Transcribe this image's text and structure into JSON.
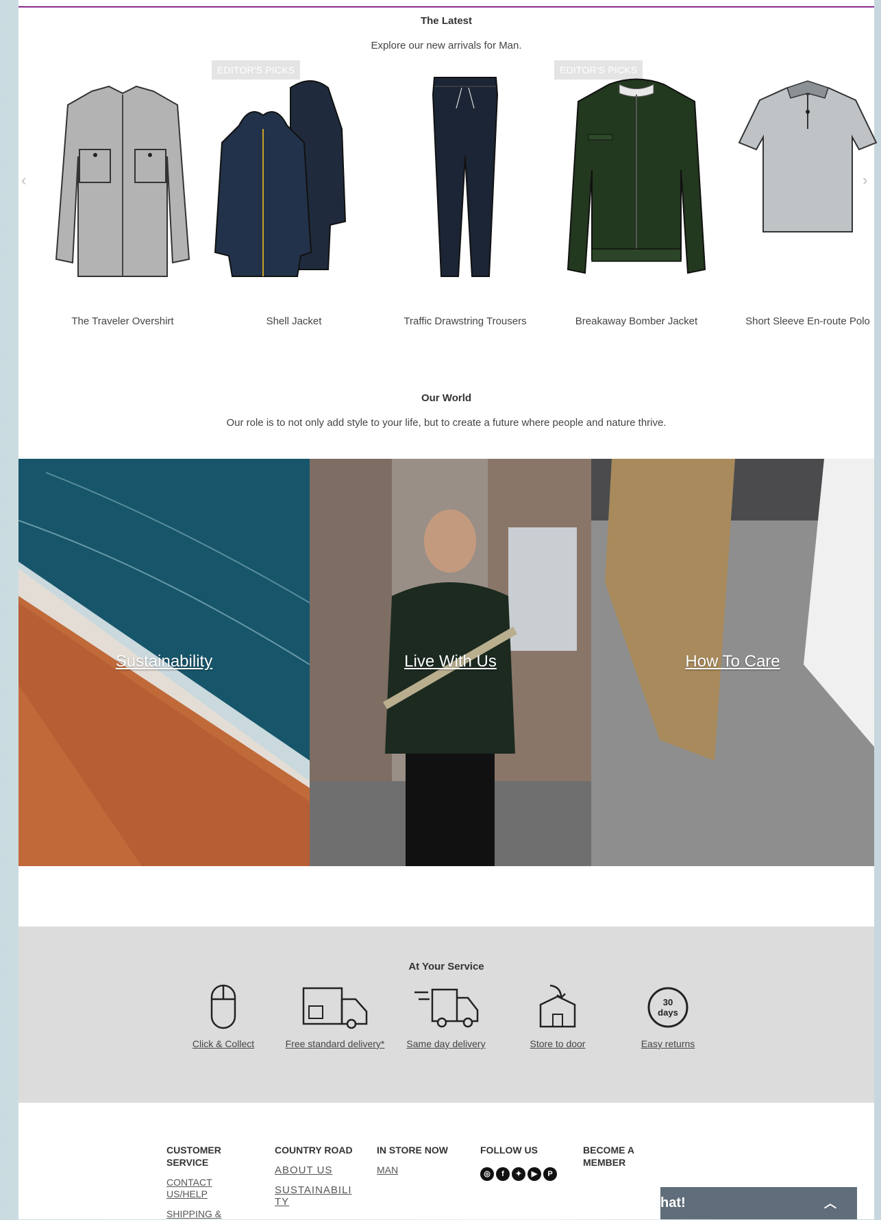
{
  "latest": {
    "title": "The Latest",
    "subtitle": "Explore our new arrivals for Man.",
    "badge": "EDITOR'S PICKS",
    "products": [
      {
        "name": "The Traveler Overshirt",
        "color": "#b3b3b3",
        "editors_pick": false
      },
      {
        "name": "Shell Jacket",
        "color": "#1f2b3d",
        "editors_pick": true
      },
      {
        "name": "Traffic Drawstring Trousers",
        "color": "#1c2535",
        "editors_pick": false
      },
      {
        "name": "Breakaway Bomber Jacket",
        "color": "#23391f",
        "editors_pick": true
      },
      {
        "name": "Short Sleeve En-route Polo",
        "color": "#bfc3c6",
        "editors_pick": false
      }
    ],
    "prev_icon": "chevron-left-icon",
    "next_icon": "chevron-right-icon",
    "next_glyph": "›"
  },
  "world": {
    "title": "Our World",
    "subtitle": "Our role is to not only add style to your life, but to create a future where people and nature thrive.",
    "tiles": [
      {
        "label": "Sustainability"
      },
      {
        "label": "Live With Us"
      },
      {
        "label": "How To Care"
      }
    ]
  },
  "service": {
    "title": "At Your Service",
    "items": [
      {
        "label": "Click & Collect",
        "icon": "mouse-icon"
      },
      {
        "label": "Free standard delivery*",
        "icon": "delivery-truck-icon"
      },
      {
        "label": "Same day delivery",
        "icon": "fast-truck-icon"
      },
      {
        "label": "Store to door",
        "icon": "store-box-icon"
      },
      {
        "label": "Easy returns",
        "icon": "thirty-days-icon"
      }
    ],
    "returns_icon_text": {
      "top": "30",
      "bottom": "days"
    }
  },
  "footer": {
    "customer_service": {
      "heading": "CUSTOMER SERVICE",
      "links": [
        "CONTACT US/HELP",
        "SHIPPING &"
      ]
    },
    "country_road": {
      "heading": "COUNTRY ROAD",
      "links": [
        "ABOUT US",
        "SUSTAINABILITY"
      ]
    },
    "in_store_now": {
      "heading": "IN STORE NOW",
      "links": [
        "MAN"
      ]
    },
    "follow_us": {
      "heading": "FOLLOW US",
      "icons": [
        "instagram-icon",
        "facebook-icon",
        "twitter-icon",
        "youtube-icon",
        "pinterest-icon"
      ]
    },
    "become_member": {
      "heading": "BECOME A MEMBER"
    }
  },
  "chat": {
    "label": "hat!",
    "icon": "chevron-up-icon"
  }
}
